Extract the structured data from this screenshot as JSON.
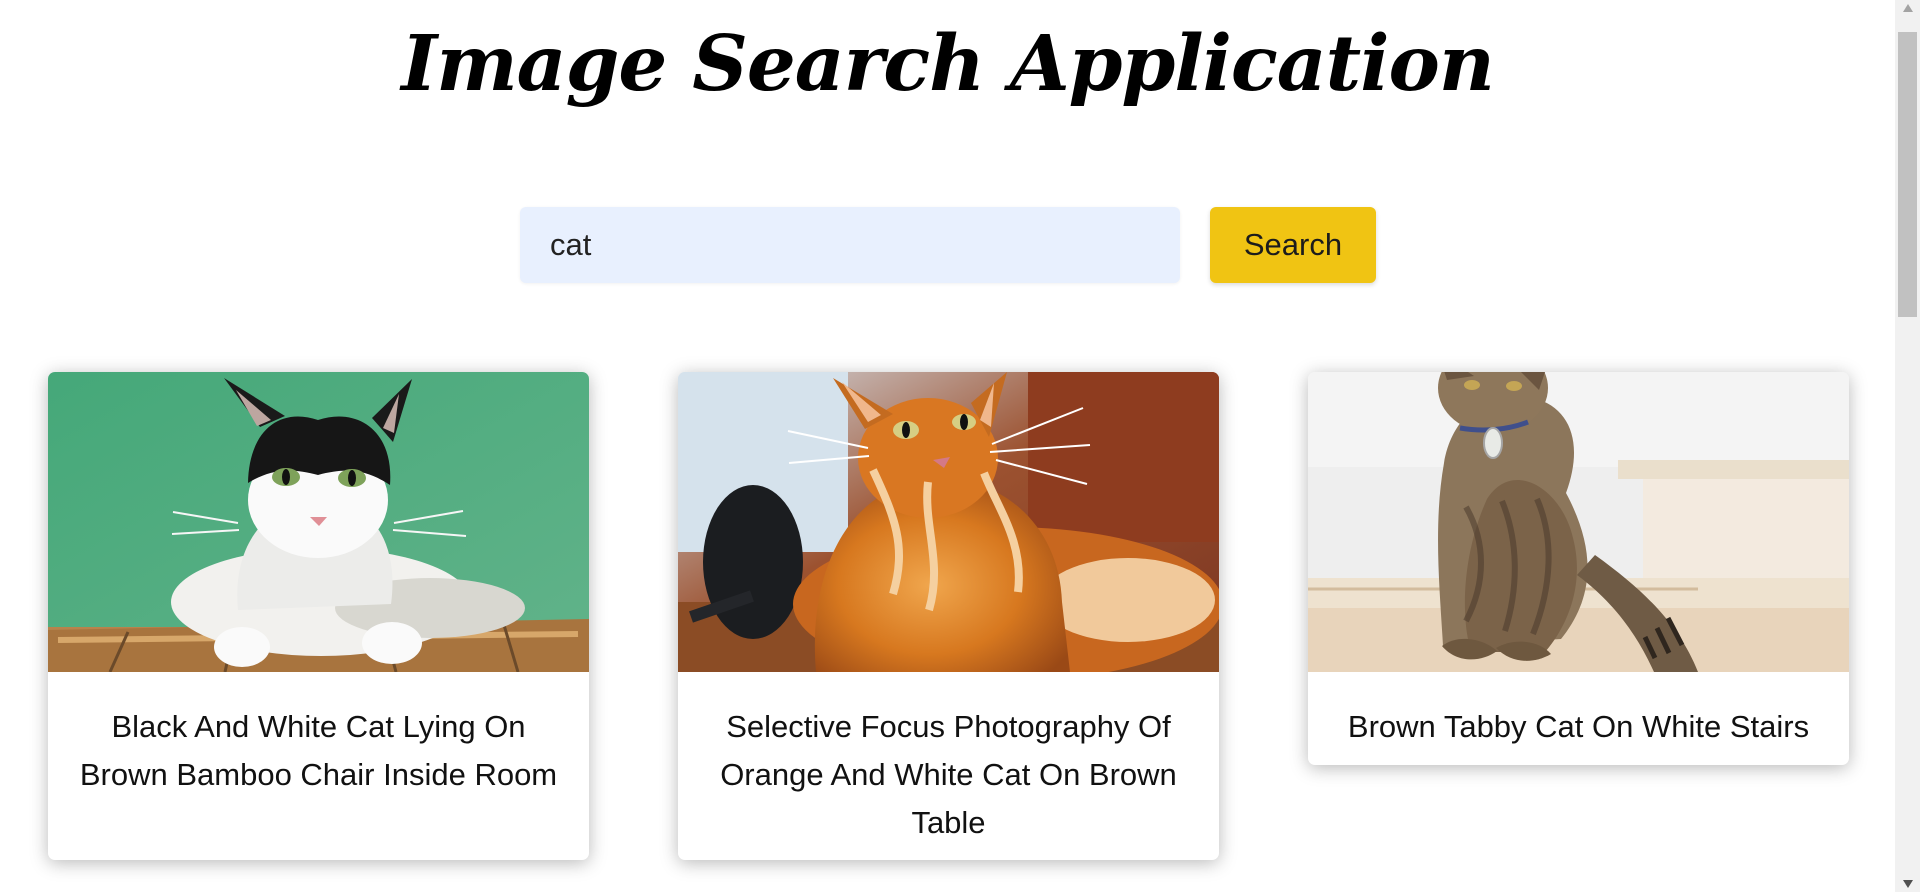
{
  "header": {
    "title": "Image Search Application"
  },
  "search": {
    "query": "cat",
    "button_label": "Search"
  },
  "results": [
    {
      "caption": "Black And White Cat Lying On Brown Bamboo Chair Inside Room"
    },
    {
      "caption": "Selective Focus Photography Of Orange And White Cat On Brown Table"
    },
    {
      "caption": "Brown Tabby Cat On White Stairs"
    }
  ],
  "colors": {
    "search_input_background": "#e8f0fe",
    "search_button_background": "#f0c413",
    "page_background": "#ffffff"
  },
  "icons": {
    "scroll_up": "triangle-up",
    "scroll_down": "triangle-down"
  }
}
